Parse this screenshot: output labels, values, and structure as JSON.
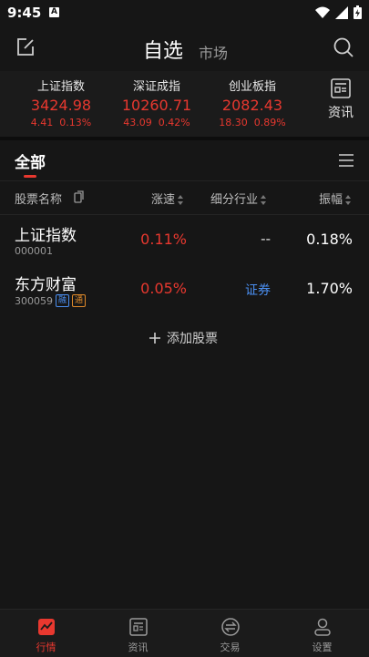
{
  "status_bar": {
    "time": "9:45",
    "notification_badge": "A"
  },
  "nav": {
    "title": "自选",
    "market_tab": "市场"
  },
  "indices": [
    {
      "name": "上证指数",
      "value": "3424.98",
      "change": "4.41",
      "change_pct": "0.13%"
    },
    {
      "name": "深证成指",
      "value": "10260.71",
      "change": "43.09",
      "change_pct": "0.42%"
    },
    {
      "name": "创业板指",
      "value": "2082.43",
      "change": "18.30",
      "change_pct": "0.89%"
    }
  ],
  "news_button": {
    "label": "资讯"
  },
  "group_tab": {
    "label": "全部"
  },
  "columns": {
    "name": "股票名称",
    "speed": "涨速",
    "industry": "细分行业",
    "amplitude": "振幅"
  },
  "rows": [
    {
      "name": "上证指数",
      "code": "000001",
      "speed": "0.11%",
      "industry": "--",
      "amplitude": "0.18%"
    },
    {
      "name": "东方财富",
      "code": "300059",
      "tags": [
        "融",
        "通"
      ],
      "speed": "0.05%",
      "industry": "证券",
      "amplitude": "1.70%"
    }
  ],
  "add_stock": {
    "label": "添加股票"
  },
  "bottom_nav": [
    {
      "label": "行情",
      "active": true
    },
    {
      "label": "资讯"
    },
    {
      "label": "交易"
    },
    {
      "label": "设置"
    }
  ],
  "colors": {
    "up": "#e8382f",
    "link": "#4a8ef0",
    "background": "#121212"
  }
}
